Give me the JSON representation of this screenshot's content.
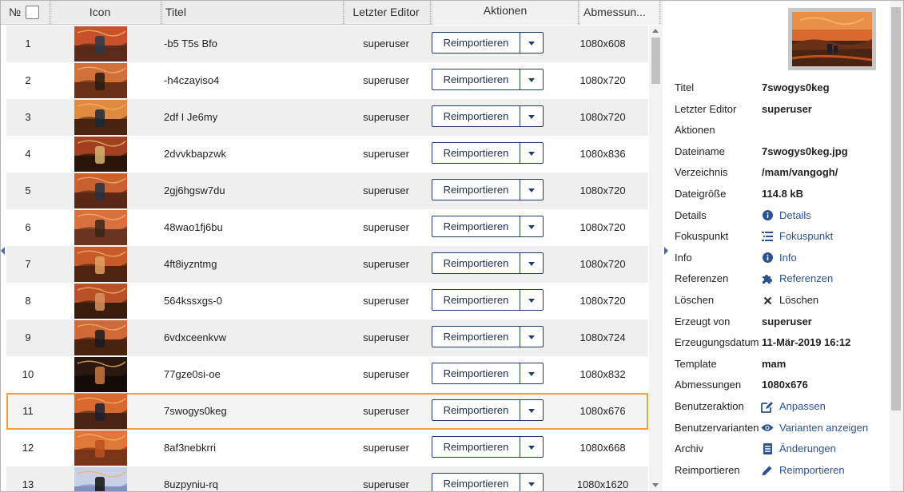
{
  "grid": {
    "columns": {
      "no": "№",
      "icon": "Icon",
      "titel": "Titel",
      "editor": "Letzter Editor",
      "aktionen": "Aktionen",
      "abmessungen": "Abmessun..."
    },
    "rows": [
      {
        "no": "1",
        "titel": "-b5 T5s Bfo",
        "editor": "superuser",
        "action": "Reimportieren",
        "abm": "1080x608",
        "thumb": {
          "sky": "#c8502a",
          "ground": "#5a2a1a",
          "accent": "#2a3a4a"
        }
      },
      {
        "no": "2",
        "titel": "-h4czayiso4",
        "editor": "superuser",
        "action": "Reimportieren",
        "abm": "1080x720",
        "thumb": {
          "sky": "#d2703a",
          "ground": "#6a3018",
          "accent": "#2a1a10"
        }
      },
      {
        "no": "3",
        "titel": "2df I Je6my",
        "editor": "superuser",
        "action": "Reimportieren",
        "abm": "1080x720",
        "thumb": {
          "sky": "#e08a40",
          "ground": "#4a2410",
          "accent": "#1a2838"
        }
      },
      {
        "no": "4",
        "titel": "2dvvkbapzwk",
        "editor": "superuser",
        "action": "Reimportieren",
        "abm": "1080x836",
        "thumb": {
          "sky": "#a04020",
          "ground": "#2a1408",
          "accent": "#d8b070"
        }
      },
      {
        "no": "5",
        "titel": "2gj6hgsw7du",
        "editor": "superuser",
        "action": "Reimportieren",
        "abm": "1080x720",
        "thumb": {
          "sky": "#c86030",
          "ground": "#5a2814",
          "accent": "#2a3040"
        }
      },
      {
        "no": "6",
        "titel": "48wao1fj6bu",
        "editor": "superuser",
        "action": "Reimportieren",
        "abm": "1080x720",
        "thumb": {
          "sky": "#d87040",
          "ground": "#6a3420",
          "accent": "#3a2418"
        }
      },
      {
        "no": "7",
        "titel": "4ft8iyzntmg",
        "editor": "superuser",
        "action": "Reimportieren",
        "abm": "1080x720",
        "thumb": {
          "sky": "#c85a28",
          "ground": "#502410",
          "accent": "#e0a060"
        }
      },
      {
        "no": "8",
        "titel": "564kssxgs-0",
        "editor": "superuser",
        "action": "Reimportieren",
        "abm": "1080x720",
        "thumb": {
          "sky": "#b85028",
          "ground": "#3a1c0c",
          "accent": "#d89060"
        }
      },
      {
        "no": "9",
        "titel": "6vdxceenkvw",
        "editor": "superuser",
        "action": "Reimportieren",
        "abm": "1080x724",
        "thumb": {
          "sky": "#d06838",
          "ground": "#4a2210",
          "accent": "#1a1a20"
        }
      },
      {
        "no": "10",
        "titel": "77gze0si-oe",
        "editor": "superuser",
        "action": "Reimportieren",
        "abm": "1080x832",
        "thumb": {
          "sky": "#2a1810",
          "ground": "#140c08",
          "accent": "#c87840"
        }
      },
      {
        "no": "11",
        "titel": "7swogys0keg",
        "editor": "superuser",
        "action": "Reimportieren",
        "abm": "1080x676",
        "thumb": {
          "sky": "#d86a30",
          "ground": "#4a2412",
          "accent": "#1a2030"
        }
      },
      {
        "no": "12",
        "titel": "8af3nebkrri",
        "editor": "superuser",
        "action": "Reimportieren",
        "abm": "1080x668",
        "thumb": {
          "sky": "#e07838",
          "ground": "#7a3418",
          "accent": "#b85020"
        }
      },
      {
        "no": "13",
        "titel": "8uzpyniu-rq",
        "editor": "superuser",
        "action": "Reimportieren",
        "abm": "1080x1620",
        "thumb": {
          "sky": "#c8d0e8",
          "ground": "#8090c0",
          "accent": "#101010"
        }
      }
    ],
    "selected_index": 10
  },
  "details": {
    "rows": [
      {
        "label": "Titel",
        "value": "7swogys0keg"
      },
      {
        "label": "Letzter Editor",
        "value": "superuser"
      },
      {
        "label": "Aktionen",
        "value": ""
      },
      {
        "label": "Dateiname",
        "value": "7swogys0keg.jpg"
      },
      {
        "label": "Verzeichnis",
        "value": "/mam/vangogh/"
      },
      {
        "label": "Dateigröße",
        "value": "114.8 kB"
      },
      {
        "label": "Details",
        "link": "Details",
        "icon": "info-icon"
      },
      {
        "label": "Fokuspunkt",
        "link": "Fokuspunkt",
        "icon": "list-icon"
      },
      {
        "label": "Info",
        "link": "Info",
        "icon": "info-icon"
      },
      {
        "label": "Referenzen",
        "link": "Referenzen",
        "icon": "puzzle-icon"
      },
      {
        "label": "Löschen",
        "link": "Löschen",
        "icon": "close-icon"
      },
      {
        "label": "Erzeugt von",
        "value": "superuser"
      },
      {
        "label": "Erzeugungsdatum",
        "value": "11-Mär-2019 16:12"
      },
      {
        "label": "Template",
        "value": "mam"
      },
      {
        "label": "Abmessungen",
        "value": "1080x676"
      },
      {
        "label": "Benutzeraktion",
        "link": "Anpassen",
        "icon": "edit-icon"
      },
      {
        "label": "Benutzervarianten",
        "link": "Varianten anzeigen",
        "icon": "eye-icon"
      },
      {
        "label": "Archiv",
        "link": "Änderungen",
        "icon": "document-icon"
      },
      {
        "label": "Reimportieren",
        "link": "Reimportieren",
        "icon": "pencil-icon"
      }
    ]
  },
  "colors": {
    "link": "#2a5294",
    "button_border": "#1f3d6f",
    "selection": "#f0a040",
    "row_alt": "#efefef"
  }
}
